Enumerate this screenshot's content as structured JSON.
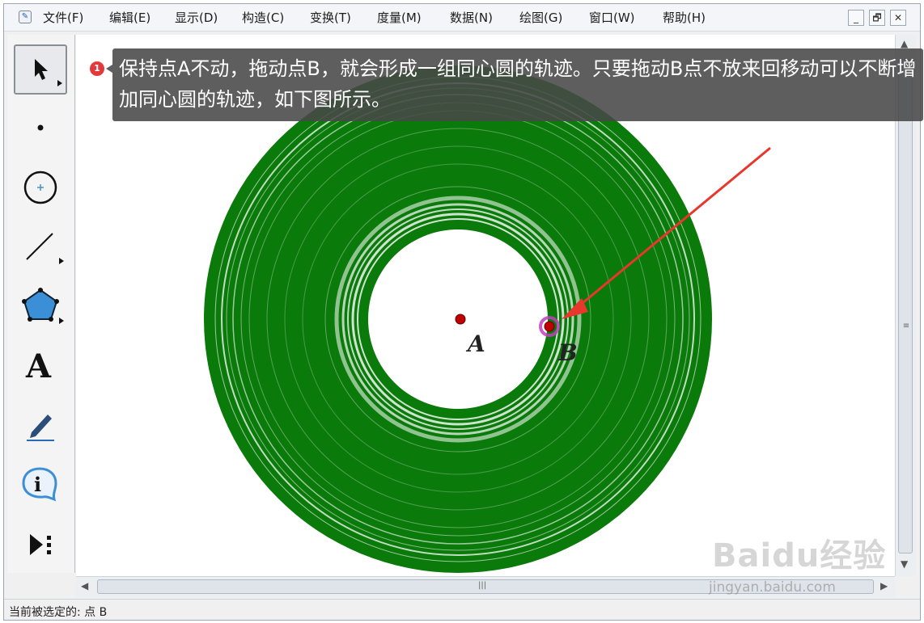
{
  "menu": {
    "items": [
      "文件(F)",
      "编辑(E)",
      "显示(D)",
      "构造(C)",
      "变换(T)",
      "度量(M)",
      "数据(N)",
      "绘图(G)",
      "窗口(W)",
      "帮助(H)"
    ]
  },
  "window_controls": {
    "minimize": "_",
    "restore": "🗗",
    "close": "✕"
  },
  "tools": [
    {
      "name": "arrow-select-tool",
      "has_submenu": true
    },
    {
      "name": "point-tool",
      "has_submenu": false
    },
    {
      "name": "compass-tool",
      "has_submenu": false
    },
    {
      "name": "straightedge-tool",
      "has_submenu": true
    },
    {
      "name": "polygon-tool",
      "has_submenu": true
    },
    {
      "name": "text-tool",
      "has_submenu": false
    },
    {
      "name": "marker-tool",
      "has_submenu": false
    },
    {
      "name": "information-tool",
      "has_submenu": false
    },
    {
      "name": "custom-tool",
      "has_submenu": false
    }
  ],
  "canvas": {
    "point_a_label": "A",
    "point_b_label": "B",
    "trace_color": "#0a7a0a",
    "point_color": "#c00000",
    "selection_color": "#c040c0",
    "arrow_color": "#e8372c"
  },
  "annotation": {
    "step": "1",
    "text": "保持点A不动，拖动点B，就会形成一组同心圆的轨迹。只要拖动B点不放来回移动可以不断增加同心圆的轨迹，如下图所示。"
  },
  "status": {
    "text": "当前被选定的: 点 B"
  },
  "watermark": {
    "logo": "Baidu经验",
    "url": "jingyan.baidu.com"
  }
}
